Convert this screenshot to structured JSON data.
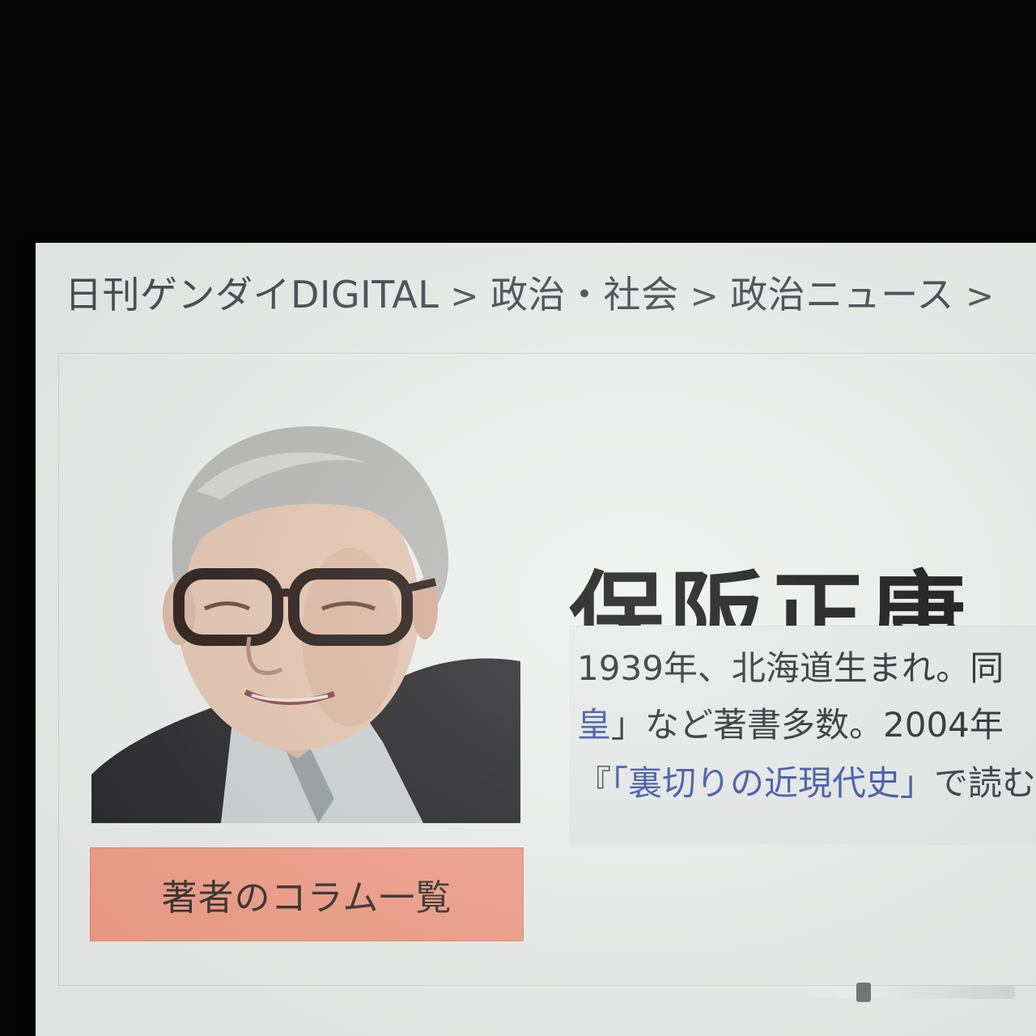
{
  "breadcrumb": {
    "items": [
      "日刊ゲンダイDIGITAL",
      "政治・社会",
      "政治ニュース"
    ],
    "separator": ">"
  },
  "author": {
    "name": "保阪正康",
    "photo_alt": "著者写真"
  },
  "bio": {
    "line1": "1939年、北海道生まれ。同",
    "line2_link": "皇",
    "line2_rest": "」など著書多数。2004年",
    "line3_prefix": "『",
    "line3_link": "「裏切りの近現代史」",
    "line3_rest": "で読む"
  },
  "buttons": {
    "columns_label": "著者のコラム一覧"
  },
  "colors": {
    "columns_button_bg": "#f4a28c",
    "link": "#3f55a8",
    "page_bg": "#eef1ef"
  },
  "icons": {
    "breadcrumb_separator": "chevron-right-icon"
  }
}
